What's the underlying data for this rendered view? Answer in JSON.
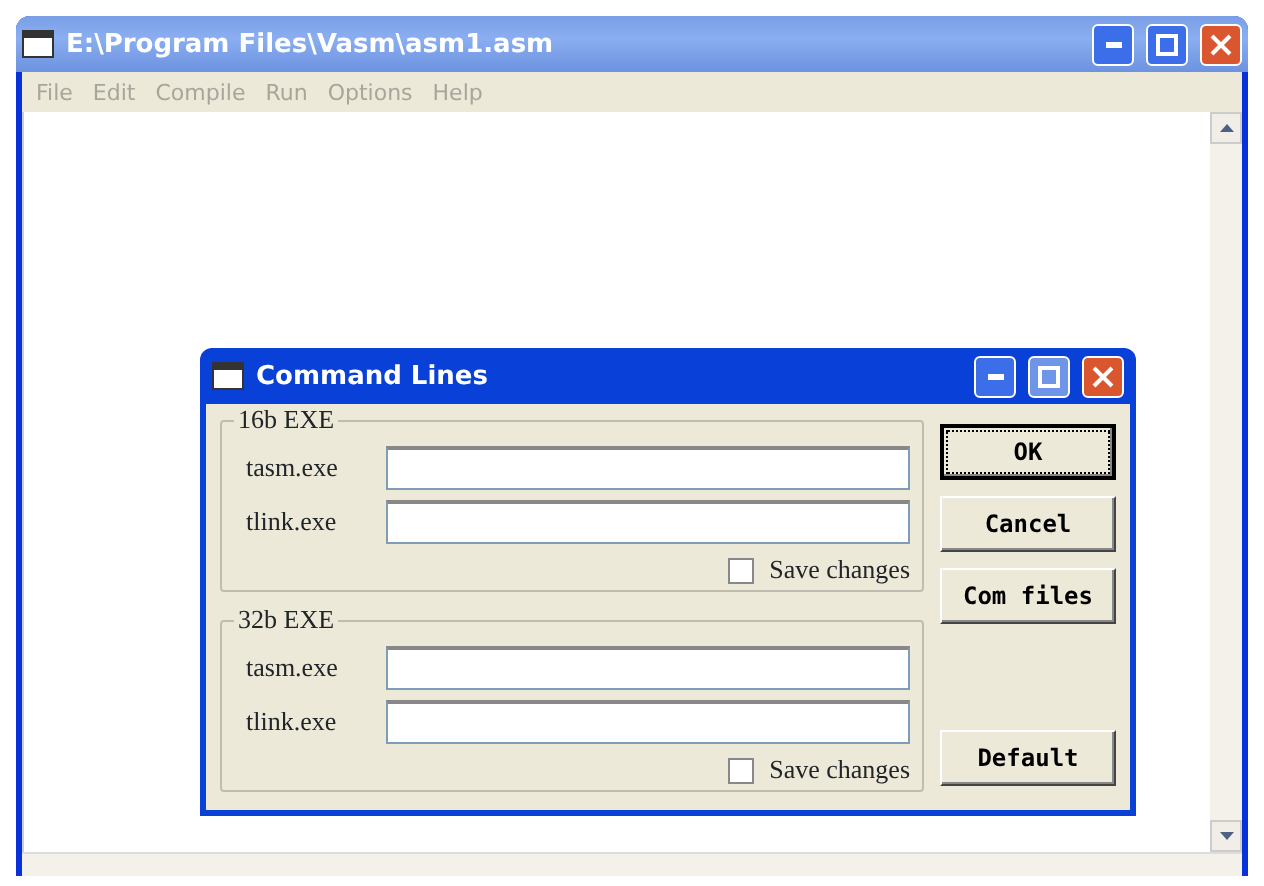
{
  "window": {
    "title": "E:\\Program Files\\Vasm\\asm1.asm"
  },
  "menu": [
    {
      "label": "File",
      "disabled": true
    },
    {
      "label": "Edit",
      "disabled": true
    },
    {
      "label": "Compile",
      "disabled": true
    },
    {
      "label": "Run",
      "disabled": true
    },
    {
      "label": "Options",
      "disabled": true
    },
    {
      "label": "Help",
      "disabled": true
    }
  ],
  "dialog": {
    "title": "Command Lines",
    "groups": [
      {
        "title": "16b EXE",
        "fields": [
          {
            "label": "tasm.exe"
          },
          {
            "label": "tlink.exe"
          }
        ],
        "save": {
          "label": "Save changes",
          "checked": false
        }
      },
      {
        "title": "32b EXE",
        "fields": [
          {
            "label": "tasm.exe"
          },
          {
            "label": "tlink.exe"
          }
        ],
        "save": {
          "label": "Save changes",
          "checked": false
        }
      }
    ],
    "buttons": [
      {
        "label": "OK",
        "kind": "default"
      },
      {
        "label": "Cancel",
        "kind": "normal"
      },
      {
        "label": "Com files",
        "kind": "normal"
      },
      {
        "label": "Default",
        "kind": "bottom"
      }
    ]
  }
}
